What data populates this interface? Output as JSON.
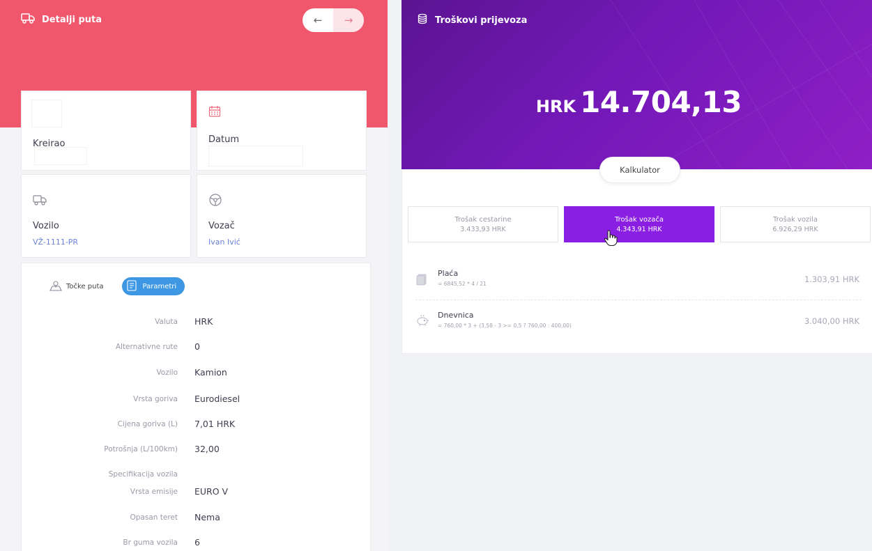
{
  "left": {
    "title": "Detalji puta",
    "nav_back": "←",
    "nav_forward": "→",
    "cards": {
      "created_label": "Kreirao",
      "date_label": "Datum",
      "vehicle_label": "Vozilo",
      "vehicle_value": "VŽ-1111-PR",
      "driver_label": "Vozač",
      "driver_value": "Ivan Ivić"
    },
    "tabs": {
      "points": "Točke puta",
      "params": "Parametri"
    },
    "params": [
      {
        "key": "Valuta",
        "value": "HRK"
      },
      {
        "key": "Alternativne rute",
        "value": "0"
      },
      {
        "key": "Vozilo",
        "value": "Kamion"
      },
      {
        "key": "Vrsta goriva",
        "value": "Eurodiesel"
      },
      {
        "key": "Cijena goriva (L)",
        "value": "7,01 HRK"
      },
      {
        "key": "Potrošnja (L/100km)",
        "value": "32,00"
      },
      {
        "key": "Specifikacija vozila",
        "value": ""
      },
      {
        "key": "Vrsta emisije",
        "value": "EURO V"
      },
      {
        "key": "Opasan teret",
        "value": "Nema"
      },
      {
        "key": "Br guma vozila",
        "value": "6"
      }
    ]
  },
  "right": {
    "title": "Troškovi prijevoza",
    "total_currency": "HRK",
    "total_value": "14.704,13",
    "calculator_label": "Kalkulator",
    "cost_tabs": [
      {
        "name": "Trošak cestarine",
        "amount": "3.433,93 HRK"
      },
      {
        "name": "Trošak vozača",
        "amount": "4.343,91 HRK"
      },
      {
        "name": "Trošak vozila",
        "amount": "6.926,29 HRK"
      }
    ],
    "cost_rows": [
      {
        "name": "Plaća",
        "formula": "= 6845,52 * 4 / 21",
        "amount": "1.303,91 HRK"
      },
      {
        "name": "Dnevnica",
        "formula": "= 760,00 * 3 + (3,58 - 3 >= 0,5 ? 760,00 : 400,00)",
        "amount": "3.040,00 HRK"
      }
    ]
  },
  "colors": {
    "left_accent": "#f0566c",
    "right_accent": "#7a19be",
    "active_tab": "#8a1fe3",
    "params_tab": "#3d97e3",
    "link": "#6b83d9"
  }
}
